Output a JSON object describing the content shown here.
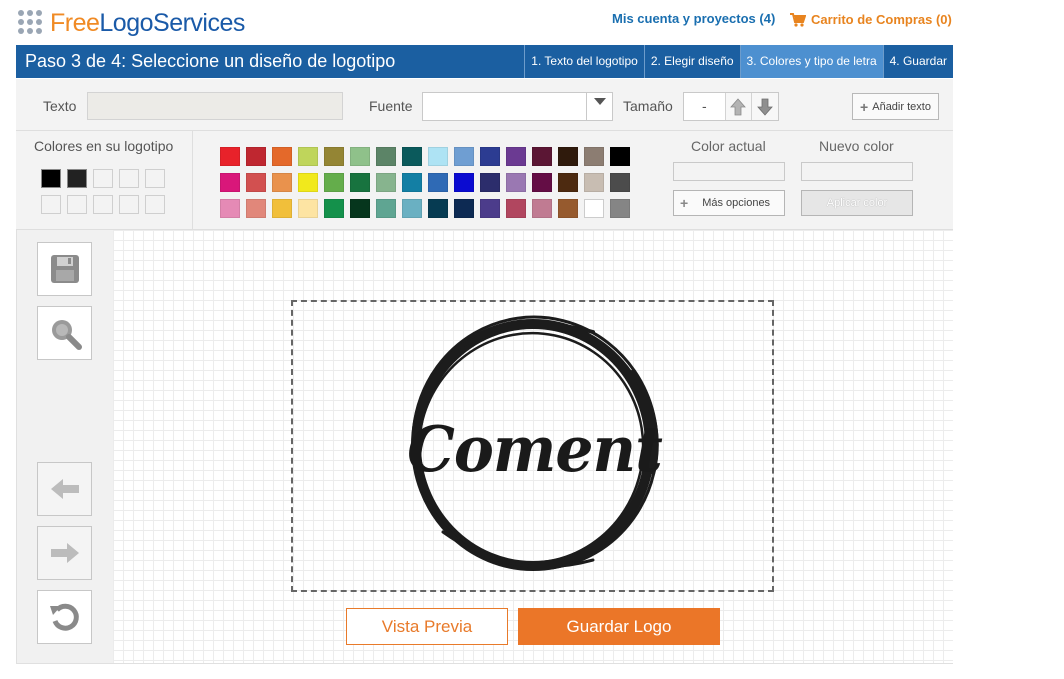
{
  "header": {
    "brand": {
      "part1": "Free",
      "part2": "Logo",
      "part3": "Services"
    },
    "account_link": "Mis cuenta y proyectos (4)",
    "cart_link": "Carrito de Compras (0)"
  },
  "stepbar": {
    "title": "Paso 3 de 4: Seleccione un diseño de logotipo",
    "steps": [
      {
        "label": "1. Texto del logotipo",
        "active": false
      },
      {
        "label": "2. Elegir diseño",
        "active": false
      },
      {
        "label": "3. Colores y tipo de letra",
        "active": true
      },
      {
        "label": "4. Guardar",
        "active": false
      }
    ]
  },
  "tools": {
    "text_label": "Texto",
    "text_value": "",
    "font_label": "Fuente",
    "font_value": "",
    "size_label": "Tamaño",
    "size_value": "-",
    "add_text_label": "Añadir texto"
  },
  "colors": {
    "logo_colors_title": "Colores en su logotipo",
    "logo_colors": [
      "#000000",
      "#222222",
      "",
      "",
      "",
      "",
      "",
      "",
      "",
      ""
    ],
    "palette": [
      [
        "#e8222a",
        "#bf2730",
        "#e4692a",
        "#bfd55b",
        "#948534",
        "#8fc18a",
        "#5c8467",
        "#0b5a5c",
        "#aee3f4",
        "#6f9ed2",
        "#2c3c92",
        "#6b3a92",
        "#5b1634",
        "#2f1a0c",
        "#8c7d72",
        "#000000"
      ],
      [
        "#d9177a",
        "#d25050",
        "#e9924d",
        "#f1e91c",
        "#64ad4b",
        "#18733f",
        "#87b48e",
        "#137fa4",
        "#2f6ab5",
        "#0b0bd1",
        "#2c2d6c",
        "#9a78b2",
        "#640d45",
        "#4d2a10",
        "#c8bdb2",
        "#4c4c4c"
      ],
      [
        "#e58ab5",
        "#e1877a",
        "#f1bf3a",
        "#fde4a3",
        "#14914b",
        "#06361d",
        "#5fa592",
        "#6ab0c2",
        "#063b52",
        "#0d2a53",
        "#4c3c8b",
        "#b1465f",
        "#c07b92",
        "#965a2e",
        "#ffffff",
        "#858585"
      ]
    ],
    "current_color_label": "Color actual",
    "new_color_label": "Nuevo color",
    "more_options_label": "Más opciones",
    "apply_color_label": "Aplicar color"
  },
  "canvas": {
    "logo_text": "Coment",
    "preview_label": "Vista Previa",
    "save_label": "Guardar Logo"
  }
}
